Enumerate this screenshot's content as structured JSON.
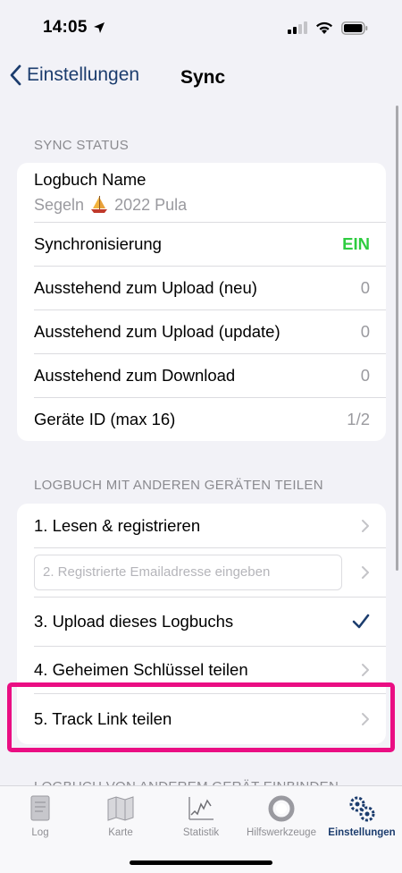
{
  "status": {
    "time": "14:05"
  },
  "nav": {
    "back_label": "Einstellungen",
    "title": "Sync"
  },
  "sync_status": {
    "header": "SYNC STATUS",
    "logbook_name_label": "Logbuch Name",
    "logbook_name_value_prefix": "Segeln",
    "logbook_name_value_suffix": "2022 Pula",
    "rows": [
      {
        "label": "Synchronisierung",
        "value": "EIN"
      },
      {
        "label": "Ausstehend zum Upload (neu)",
        "value": "0"
      },
      {
        "label": "Ausstehend zum Upload (update)",
        "value": "0"
      },
      {
        "label": "Ausstehend zum Download",
        "value": "0"
      },
      {
        "label": "Geräte ID (max 16)",
        "value": "1/2"
      }
    ]
  },
  "share": {
    "header": "LOGBUCH MIT ANDEREN GERÄTEN TEILEN",
    "step1": "1. Lesen & registrieren",
    "email_placeholder": "2. Registrierte Emailadresse eingeben",
    "step3": "3. Upload dieses Logbuchs",
    "step4": "4. Geheimen Schlüssel teilen",
    "step5": "5. Track Link teilen"
  },
  "next_section_header": "LOGBUCH VON ANDEREM GERÄT EINBINDEN",
  "tabs": [
    {
      "label": "Log",
      "icon": "log-icon"
    },
    {
      "label": "Karte",
      "icon": "map-icon"
    },
    {
      "label": "Statistik",
      "icon": "chart-icon"
    },
    {
      "label": "Hilfswerkzeuge",
      "icon": "lifebuoy-icon"
    },
    {
      "label": "Einstellungen",
      "icon": "gears-icon"
    }
  ],
  "colors": {
    "accent": "#1c3d6e",
    "on": "#2ecc40",
    "highlight": "#ea0e83"
  }
}
